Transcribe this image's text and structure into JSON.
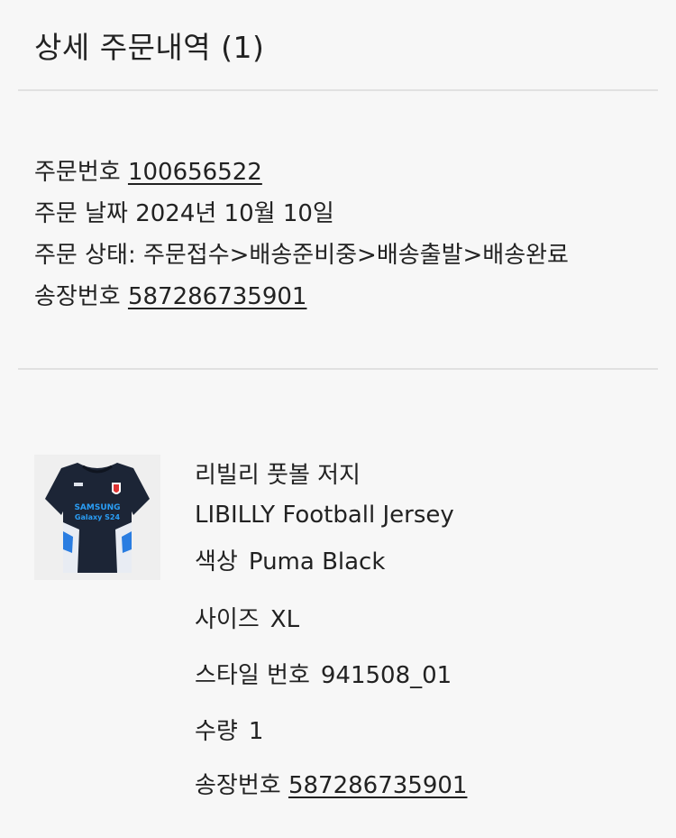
{
  "page": {
    "title": "상세 주문내역 (1)"
  },
  "order": {
    "number_label": "주문번호",
    "number_value": "100656522",
    "date_text": "주문 날짜 2024년 10월 10일",
    "status_text": "주문 상태: 주문접수>배송준비중>배송출발>배송완료",
    "invoice_label": "송장번호",
    "invoice_value": "587286735901"
  },
  "product": {
    "image_text": "SAMSUNG Galaxy S24",
    "name_ko": "리빌리 풋볼 저지",
    "name_en": "LIBILLY Football Jersey",
    "color_label": "색상",
    "color_value": "Puma Black",
    "size_label": "사이즈",
    "size_value": "XL",
    "style_label": "스타일 번호",
    "style_value": "941508_01",
    "qty_label": "수량",
    "qty_value": "1",
    "invoice_label": "송장번호",
    "invoice_value": "587286735901"
  },
  "colors": {
    "jersey_body": "#1c2536",
    "jersey_accent": "#2a7de1",
    "jersey_sides": "#e8ecf3"
  }
}
